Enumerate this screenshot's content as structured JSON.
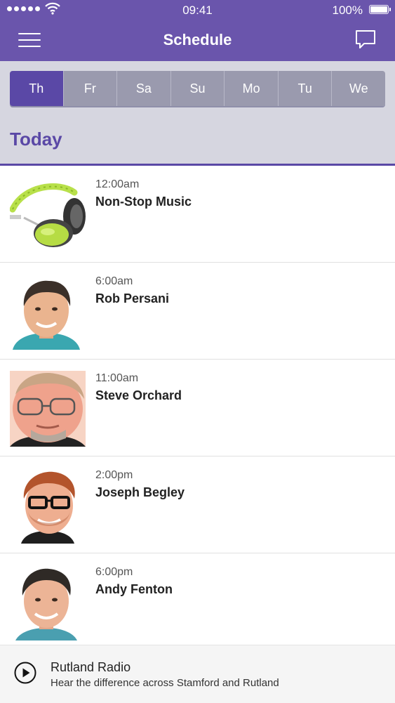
{
  "status_bar": {
    "time": "09:41",
    "battery_percent": "100%"
  },
  "nav": {
    "title": "Schedule",
    "left_icon": "hamburger-menu-icon",
    "right_icon": "chat-bubble-icon"
  },
  "day_tabs": [
    {
      "label": "Th",
      "active": true
    },
    {
      "label": "Fr",
      "active": false
    },
    {
      "label": "Sa",
      "active": false
    },
    {
      "label": "Su",
      "active": false
    },
    {
      "label": "Mo",
      "active": false
    },
    {
      "label": "Tu",
      "active": false
    },
    {
      "label": "We",
      "active": false
    }
  ],
  "section": {
    "heading": "Today"
  },
  "shows": [
    {
      "time": "12:00am",
      "name": "Non-Stop Music",
      "image": "headphones"
    },
    {
      "time": "6:00am",
      "name": "Rob Persani",
      "image": "presenter-photo"
    },
    {
      "time": "11:00am",
      "name": "Steve Orchard",
      "image": "presenter-photo"
    },
    {
      "time": "2:00pm",
      "name": "Joseph Begley",
      "image": "presenter-photo"
    },
    {
      "time": "6:00pm",
      "name": "Andy Fenton",
      "image": "presenter-photo"
    }
  ],
  "player": {
    "station": "Rutland Radio",
    "tagline": "Hear the difference across Stamford and Rutland",
    "icon": "play-icon"
  },
  "colors": {
    "brand_purple": "#6a55ac",
    "active_tab": "#5a48a6",
    "inactive_tab": "#9a9aae",
    "tabs_background": "#d6d6e0"
  }
}
